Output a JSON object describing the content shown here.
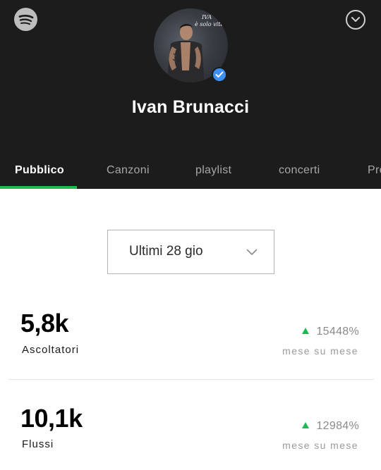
{
  "header": {
    "logo_icon": "spotify-icon",
    "collapse_icon": "chevron-down-circle-icon",
    "avatar_text_line1": "IVA",
    "avatar_text_line2": "è solo vita",
    "verified_icon": "verified-check-icon",
    "artist_name": "Ivan Brunacci",
    "background_color": "#1c1c1c"
  },
  "tabs": [
    {
      "label": "Pubblico",
      "active": true
    },
    {
      "label": "Canzoni",
      "active": false
    },
    {
      "label": "playlist",
      "active": false
    },
    {
      "label": "concerti",
      "active": false
    },
    {
      "label": "Pro",
      "active": false
    }
  ],
  "accent_color": "#1db954",
  "period_select": {
    "value": "Ultimi 28 gio",
    "icon": "chevron-down-icon"
  },
  "stats": [
    {
      "value": "5,8k",
      "label": "Ascoltatori",
      "change": "15448%",
      "trend": "up",
      "period": "mese su mese"
    },
    {
      "value": "10,1k",
      "label": "Flussi",
      "change": "12984%",
      "trend": "up",
      "period": "mese su mese"
    }
  ]
}
